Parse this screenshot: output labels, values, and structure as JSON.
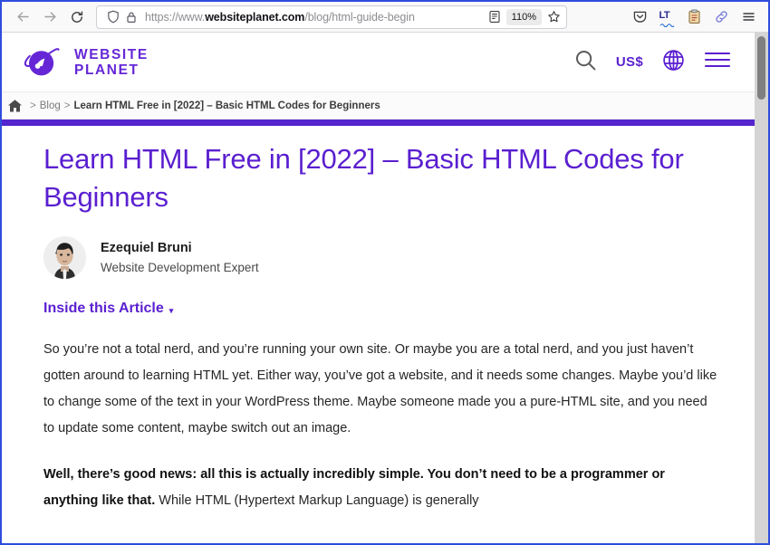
{
  "browser": {
    "back_label": "Back",
    "forward_label": "Forward",
    "reload_label": "Reload",
    "url_prefix": "https://www.",
    "url_domain": "websiteplanet.com",
    "url_path": "/blog/html-guide-begin",
    "url_full": "https://www.websiteplanet.com/blog/html-guide-begin",
    "zoom_level": "110%",
    "shield_label": "Tracking Protection",
    "lock_label": "Connection secure",
    "reader_label": "Reader View",
    "bookmark_label": "Bookmark this page",
    "toolbar_icons": [
      {
        "name": "pocket-icon",
        "label": "Save to Pocket"
      },
      {
        "name": "languagetool-icon",
        "label": "LT"
      },
      {
        "name": "clipboard-icon",
        "label": "Clipboard"
      },
      {
        "name": "link-icon",
        "label": "Copy Link"
      },
      {
        "name": "hamburger-menu-icon",
        "label": "Open application menu"
      }
    ]
  },
  "site_header": {
    "logo_line1": "WEBSITE",
    "logo_line2": "PLANET",
    "search_label": "Search",
    "currency": "US$",
    "language_label": "Language",
    "menu_label": "Menu"
  },
  "breadcrumb": {
    "home_label": "Home",
    "separator": ">",
    "blog_label": "Blog",
    "current": "Learn HTML Free in [2022] – Basic HTML Codes for Beginners"
  },
  "article": {
    "title": "Learn HTML Free in [2022] – Basic HTML Codes for Beginners",
    "author_name": "Ezequiel Bruni",
    "author_role": "Website Development Expert",
    "toc_label": "Inside this Article",
    "toc_caret": "▾",
    "paragraph_1": "So you’re not a total nerd, and you’re running your own site. Or maybe you are a total nerd, and you just haven’t gotten around to learning HTML yet. Either way, you’ve got a website, and it needs some changes. Maybe you’d like to change some of the text in your WordPress theme. Maybe someone made you a pure-HTML site, and you need to update some content, maybe switch out an image.",
    "paragraph_2_bold": "Well, there’s good news: all this is actually incredibly simple. You don’t need to be a programmer or anything like that.",
    "paragraph_2_rest": " While HTML (Hypertext Markup Language) is generally"
  },
  "colors": {
    "brand_purple": "#5a1fd0",
    "progress_bar": "#5424cf",
    "frame_border": "#2d4ddb",
    "body_text": "#262626"
  },
  "scrollbar": {
    "label": "Vertical scrollbar"
  }
}
